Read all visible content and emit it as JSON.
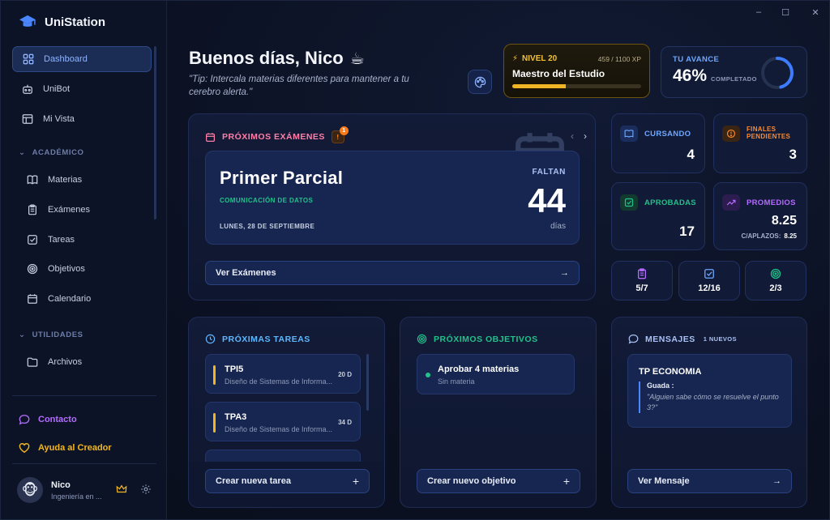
{
  "app": {
    "name": "UniStation"
  },
  "window_controls": {
    "minimize": "–",
    "maximize": "☐",
    "close": "✕"
  },
  "sidebar": {
    "items": [
      {
        "label": "Dashboard",
        "icon": "dashboard-icon",
        "active": true
      },
      {
        "label": "UniBot",
        "icon": "bot-icon"
      },
      {
        "label": "Mi Vista",
        "icon": "layout-icon"
      }
    ],
    "academic": {
      "title": "ACADÉMICO",
      "items": [
        {
          "label": "Materias",
          "icon": "book-icon"
        },
        {
          "label": "Exámenes",
          "icon": "clipboard-icon"
        },
        {
          "label": "Tareas",
          "icon": "checkbox-icon"
        },
        {
          "label": "Objetivos",
          "icon": "target-icon"
        },
        {
          "label": "Calendario",
          "icon": "calendar-icon"
        }
      ]
    },
    "utilities": {
      "title": "UTILIDADES",
      "items": [
        {
          "label": "Archivos",
          "icon": "folder-icon"
        }
      ]
    },
    "footer": {
      "contact": "Contacto",
      "help": "Ayuda al Creador",
      "contact_color": "#b46bff",
      "help_color": "#f2b61f"
    },
    "user": {
      "name": "Nico",
      "subtitle": "Ingeniería en ...",
      "avatar": "🐵"
    }
  },
  "header": {
    "greeting": "Buenos días, Nico",
    "greeting_emoji": "☕",
    "tip": "\"Tip: Intercala materias diferentes para mantener a tu cerebro alerta.\""
  },
  "level": {
    "title": "NIVEL 20",
    "xp": "459 / 1100 XP",
    "name": "Maestro del Estudio",
    "progress": 0.417
  },
  "progress": {
    "label": "TU AVANCE",
    "value": "46%",
    "suffix": "COMPLETADO",
    "fraction": 0.46
  },
  "exams": {
    "title": "PRÓXIMOS EXÁMENES",
    "badge": "1",
    "exam_name": "Primer Parcial",
    "subject": "COMUNICACIÓN DE DATOS",
    "date": "LUNES, 28 DE SEPTIEMBRE",
    "faltan": "FALTAN",
    "days": "44",
    "days_unit": "días",
    "button": "Ver Exámenes"
  },
  "stats": {
    "cursando": {
      "label": "CURSANDO",
      "value": "4",
      "color": "#6ea7ff"
    },
    "finales": {
      "label": "FINALES",
      "label2": "PENDIENTES",
      "value": "3",
      "color": "#ff8a2a"
    },
    "aprobadas": {
      "label": "APROBADAS",
      "value": "17",
      "color": "#21c28a"
    },
    "promedios": {
      "label": "PROMEDIOS",
      "value": "8.25",
      "sub_label": "C/APLAZOS:",
      "sub_value": "8.25",
      "color": "#b46bff"
    }
  },
  "mini": [
    {
      "value": "5/7",
      "icon": "clipboard-icon",
      "color": "#b46bff"
    },
    {
      "value": "12/16",
      "icon": "checkbox-icon",
      "color": "#6ea7ff"
    },
    {
      "value": "2/3",
      "icon": "target-icon",
      "color": "#21c28a"
    }
  ],
  "tasks": {
    "title": "PRÓXIMAS TAREAS",
    "items": [
      {
        "title": "TPI5",
        "subject": "Diseño de Sistemas de Informa...",
        "days": "20 D"
      },
      {
        "title": "TPA3",
        "subject": "Diseño de Sistemas de Informa...",
        "days": "34 D"
      }
    ],
    "button": "Crear nueva tarea"
  },
  "goals": {
    "title": "PRÓXIMOS OBJETIVOS",
    "items": [
      {
        "title": "Aprobar 4 materias",
        "subtitle": "Sin materia"
      }
    ],
    "button": "Crear nuevo objetivo"
  },
  "messages": {
    "title": "MENSAJES",
    "badge": "1 NUEVOS",
    "item": {
      "title": "TP ECONOMIA",
      "author": "Guada :",
      "text": "\"Alguien sabe cómo se resuelve el punto 3?\""
    },
    "button": "Ver Mensaje"
  }
}
